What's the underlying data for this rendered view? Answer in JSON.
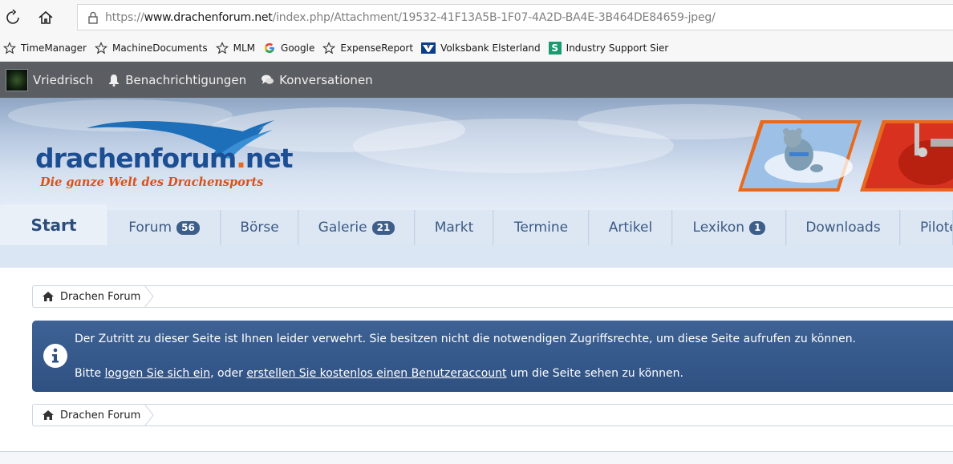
{
  "browser": {
    "url_prefix": "https://",
    "url_host": "www.drachenforum.net",
    "url_path": "/index.php/Attachment/19532-41F13A5B-1F07-4A2D-BA4E-3B464DE84659-jpeg/",
    "favorites": [
      {
        "label": "TimeManager",
        "icon": "star-outline-icon"
      },
      {
        "label": "MachineDocuments",
        "icon": "star-outline-icon"
      },
      {
        "label": "MLM",
        "icon": "star-outline-icon"
      },
      {
        "label": "Google",
        "icon": "google-g-icon"
      },
      {
        "label": "ExpenseReport",
        "icon": "star-outline-icon"
      },
      {
        "label": "Volksbank Elsterland",
        "icon": "volksbank-icon"
      },
      {
        "label": "Industry Support Sier",
        "icon": "s-green-icon"
      }
    ]
  },
  "userbar": {
    "username": "Vriedrisch",
    "notifications": "Benachrichtigungen",
    "conversations": "Konversationen"
  },
  "header": {
    "logo_name": "drachenforum",
    "logo_dot": ".",
    "logo_tld": "net",
    "slogan": "Die ganze Welt des Drachensports",
    "logo_color": "#1c4e94",
    "accent_color": "#e8691b"
  },
  "nav": {
    "tabs": [
      {
        "label": "Start",
        "badge": ""
      },
      {
        "label": "Forum",
        "badge": "56"
      },
      {
        "label": "Börse",
        "badge": ""
      },
      {
        "label": "Galerie",
        "badge": "21"
      },
      {
        "label": "Markt",
        "badge": ""
      },
      {
        "label": "Termine",
        "badge": ""
      },
      {
        "label": "Artikel",
        "badge": ""
      },
      {
        "label": "Lexikon",
        "badge": "1"
      },
      {
        "label": "Downloads",
        "badge": ""
      },
      {
        "label": "Pilote",
        "badge": ""
      }
    ]
  },
  "breadcrumb": {
    "home_label": "Drachen Forum"
  },
  "notice": {
    "line1": "Der Zutritt zu dieser Seite ist Ihnen leider verwehrt. Sie besitzen nicht die notwendigen Zugriffsrechte, um diese Seite aufrufen zu können.",
    "line2_prefix": "Bitte ",
    "login_link": "loggen Sie sich ein",
    "line2_mid": ", oder ",
    "register_link": "erstellen Sie kostenlos einen Benutzeraccount",
    "line2_suffix": " um die Seite sehen zu können."
  }
}
